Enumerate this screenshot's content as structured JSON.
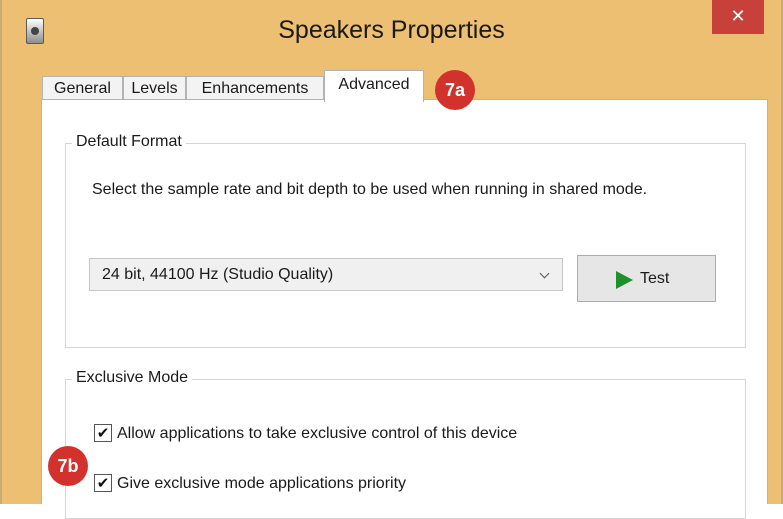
{
  "window": {
    "title": "Speakers Properties",
    "close_glyph": "✕",
    "icon": "speaker-device-icon",
    "accent_color": "#ecbf72",
    "close_color": "#c8403a"
  },
  "tabs": [
    {
      "label": "General",
      "active": false
    },
    {
      "label": "Levels",
      "active": false
    },
    {
      "label": "Enhancements",
      "active": false
    },
    {
      "label": "Advanced",
      "active": true
    }
  ],
  "annotations": {
    "a": "7a",
    "b": "7b",
    "color": "#d3322c"
  },
  "default_format": {
    "title": "Default Format",
    "description": "Select the sample rate and bit depth to be used when running in shared mode.",
    "selected_format": "24 bit, 44100 Hz (Studio Quality)",
    "test_label": "Test",
    "test_icon": "play-icon"
  },
  "exclusive_mode": {
    "title": "Exclusive Mode",
    "options": [
      {
        "label": "Allow applications to take exclusive control of this device",
        "checked": true,
        "mark": "✔"
      },
      {
        "label": "Give exclusive mode applications priority",
        "checked": true,
        "mark": "✔"
      }
    ]
  }
}
